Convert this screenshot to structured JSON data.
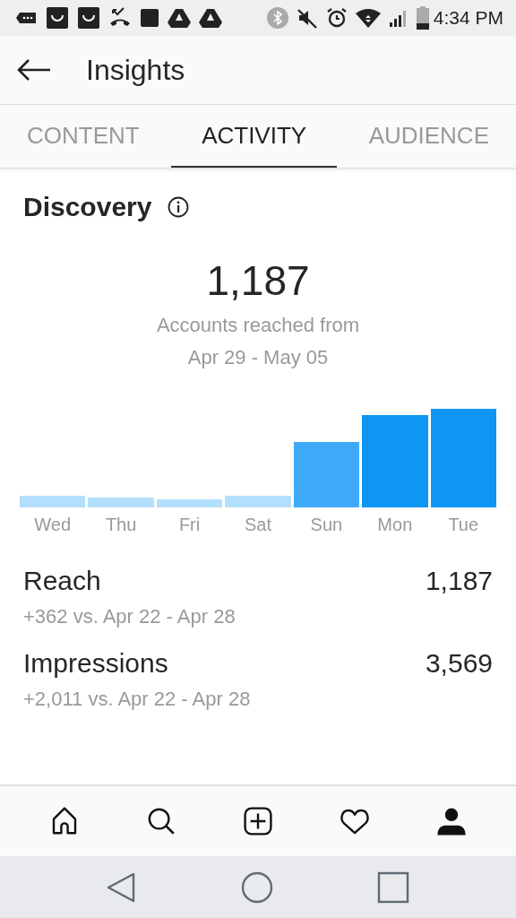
{
  "status_bar": {
    "time": "4:34 PM"
  },
  "header": {
    "title": "Insights"
  },
  "tabs": [
    {
      "label": "CONTENT",
      "selected": false
    },
    {
      "label": "ACTIVITY",
      "selected": true
    },
    {
      "label": "AUDIENCE",
      "selected": false
    }
  ],
  "discovery": {
    "title": "Discovery",
    "total": "1,187",
    "caption": "Accounts reached from",
    "range": "Apr 29 - May 05",
    "days": [
      "Wed",
      "Thu",
      "Fri",
      "Sat",
      "Sun",
      "Mon",
      "Tue"
    ]
  },
  "metrics": [
    {
      "name": "Reach",
      "value": "1,187",
      "change": "+362 vs. Apr 22 - Apr 28"
    },
    {
      "name": "Impressions",
      "value": "3,569",
      "change": "+2,011 vs. Apr 22 - Apr 28"
    }
  ],
  "bottom_nav": [
    {
      "kind": "home",
      "selected": false
    },
    {
      "kind": "search",
      "selected": false
    },
    {
      "kind": "add",
      "selected": false
    },
    {
      "kind": "heart",
      "selected": false
    },
    {
      "kind": "profile",
      "selected": true
    }
  ]
}
